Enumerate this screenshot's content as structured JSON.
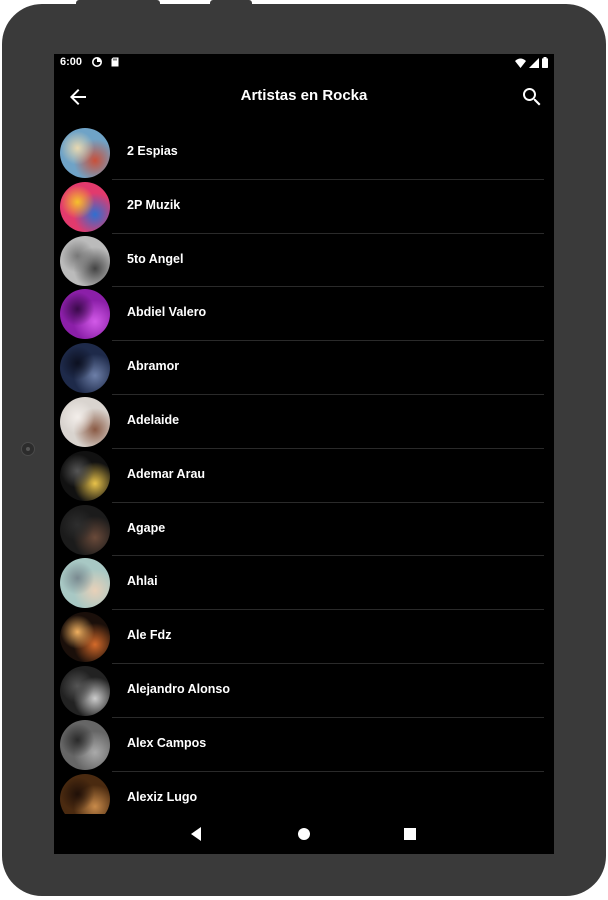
{
  "status_bar": {
    "time": "6:00",
    "icons_left": [
      "data-saver-icon",
      "sd-card-icon"
    ],
    "icons_right": [
      "wifi-icon",
      "cellular-signal-icon",
      "battery-icon"
    ]
  },
  "app_bar": {
    "title": "Artistas en Rocka",
    "back_icon": "arrow-back-icon",
    "search_icon": "search-icon"
  },
  "artists": [
    {
      "name": "2 Espias",
      "avatar_colors": [
        "#6fa3c7",
        "#c9503a",
        "#e8d8b0"
      ]
    },
    {
      "name": "2P Muzik",
      "avatar_colors": [
        "#e23a6d",
        "#2f6fd0",
        "#f5c12c"
      ]
    },
    {
      "name": "5to Angel",
      "avatar_colors": [
        "#bbbbbb",
        "#444444",
        "#777777"
      ]
    },
    {
      "name": "Abdiel Valero",
      "avatar_colors": [
        "#8b1fa8",
        "#d25ae8",
        "#3a0a4a"
      ]
    },
    {
      "name": "Abramor",
      "avatar_colors": [
        "#1e2a4a",
        "#6d7fa8",
        "#0c1020"
      ]
    },
    {
      "name": "Adelaide",
      "avatar_colors": [
        "#d9d4cf",
        "#8a5a44",
        "#f3eeea"
      ]
    },
    {
      "name": "Ademar Arau",
      "avatar_colors": [
        "#111111",
        "#e8c24a",
        "#555555"
      ]
    },
    {
      "name": "Agape",
      "avatar_colors": [
        "#1b1b1b",
        "#6a4a3a",
        "#2e2e2e"
      ]
    },
    {
      "name": "Ahlai",
      "avatar_colors": [
        "#a8c8c4",
        "#e8d0b8",
        "#7a8a90"
      ]
    },
    {
      "name": "Ale Fdz",
      "avatar_colors": [
        "#1a0f0a",
        "#d46a2a",
        "#f0b060"
      ]
    },
    {
      "name": "Alejandro Alonso",
      "avatar_colors": [
        "#222222",
        "#cccccc",
        "#555555"
      ]
    },
    {
      "name": "Alex Campos",
      "avatar_colors": [
        "#666666",
        "#aaaaaa",
        "#2a2a2a"
      ]
    },
    {
      "name": "Alexiz Lugo",
      "avatar_colors": [
        "#4a2a10",
        "#c88a4a",
        "#201008"
      ]
    }
  ],
  "nav_bar": {
    "back": "nav-back-icon",
    "home": "nav-home-icon",
    "recents": "nav-recents-icon"
  }
}
